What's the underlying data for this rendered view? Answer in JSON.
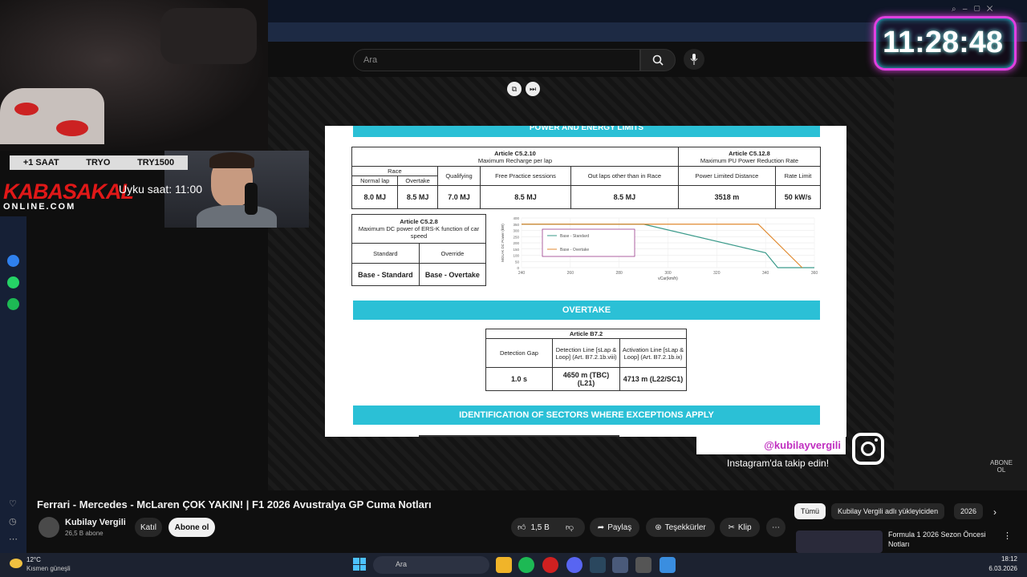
{
  "search": {
    "placeholder": "Ara"
  },
  "webcam": {
    "ticker": [
      "+1 SAAT",
      "TRYO",
      "TRY1500"
    ],
    "logo_line1": "KABASAKAL",
    "logo_line2": "ONLINE.COM",
    "sleep_note": "Uyku saat: 11:00"
  },
  "clock": {
    "time": "11:28:48"
  },
  "doc": {
    "section1": "POWER AND ENERGY LIMITS",
    "art_c5210": "Article C5.2.10",
    "art_c5210_sub": "Maximum Recharge per lap",
    "art_c5128": "Article C5.12.8",
    "art_c5128_sub": "Maximum PU Power Reduction Rate",
    "race": "Race",
    "cols": [
      "Normal lap",
      "Overtake",
      "Qualifying",
      "Free Practice sessions",
      "Out laps other than in Race",
      "Power Limited Distance",
      "Rate Limit"
    ],
    "vals": [
      "8.0 MJ",
      "8.5 MJ",
      "7.0 MJ",
      "8.5 MJ",
      "8.5 MJ",
      "3518 m",
      "50 kW/s"
    ],
    "art_c528": "Article C5.2.8",
    "art_c528_sub": "Maximum DC power of ERS-K function of car speed",
    "standard": "Standard",
    "override": "Override",
    "base_standard": "Base - Standard",
    "base_overtake": "Base - Overtake",
    "section2": "OVERTAKE",
    "art_b72": "Article B7.2",
    "detection_gap": "Detection Gap",
    "detection_line": "Detection Line [sLap & Loop] (Art. B7.2.1b.viii)",
    "activation_line": "Activation Line [sLap & Loop] (Art. B7.2.1b.ix)",
    "gap_val": "1.0 s",
    "det_val": "4650 m (TBC) (L21)",
    "act_val": "4713 m (L22/SC1)",
    "section3": "IDENTIFICATION OF SECTORS WHERE EXCEPTIONS APPLY"
  },
  "chart_data": {
    "type": "line",
    "title": "",
    "xlabel": "vCar(km/h)",
    "ylabel": "MGU-K DC Power (kW)",
    "x_ticks": [
      240,
      260,
      280,
      300,
      320,
      340,
      360
    ],
    "y_ticks": [
      0,
      50,
      100,
      150,
      200,
      250,
      300,
      350,
      400
    ],
    "xlim": [
      240,
      360
    ],
    "ylim": [
      0,
      400
    ],
    "legend_placement": "center-left",
    "series": [
      {
        "name": "Base - Standard",
        "color": "#3a9a8a",
        "x": [
          240,
          290,
          340,
          345,
          360
        ],
        "y": [
          350,
          350,
          120,
          0,
          0
        ]
      },
      {
        "name": "Base - Overtake",
        "color": "#e08a30",
        "x": [
          240,
          337,
          355
        ],
        "y": [
          350,
          350,
          0
        ]
      }
    ]
  },
  "instagram": {
    "handle": "@kubilayvergili",
    "sub": "Instagram'da takip edin!"
  },
  "video": {
    "title": "Ferrari - Mercedes - McLaren ÇOK YAKIN! | F1 2026 Avustralya GP Cuma Notları",
    "channel": "Kubilay Vergili",
    "subs": "26,5 B abone",
    "join": "Katıl",
    "subscribe": "Abone ol",
    "likes": "1,5 B",
    "share": "Paylaş",
    "thanks": "Teşekkürler",
    "clip": "Klip"
  },
  "side": {
    "chips": [
      "Tümü",
      "Kubilay Vergili adlı yükleyiciden",
      "2026"
    ],
    "rec_title": "Formula 1 2026 Sezon Öncesi Notları",
    "subscribe_small": "ABONE OL"
  },
  "taskbar": {
    "weather_temp": "12°C",
    "weather_desc": "Kısmen güneşli",
    "search": "Ara",
    "time": "18:12",
    "date": "6.03.2026"
  }
}
